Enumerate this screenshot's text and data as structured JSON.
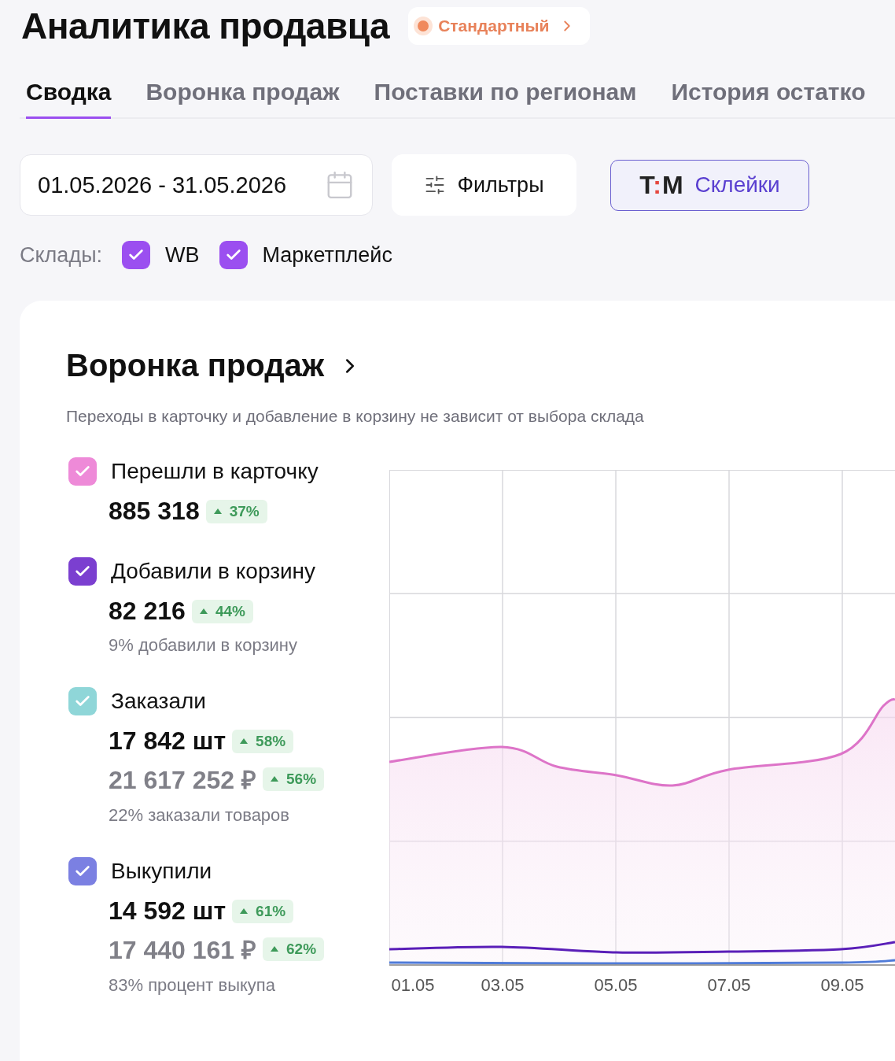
{
  "header": {
    "title": "Аналитика продавца",
    "plan_badge": {
      "label": "Стандартный"
    }
  },
  "tabs": [
    {
      "label": "Сводка",
      "selected": true
    },
    {
      "label": "Воронка продаж",
      "selected": false
    },
    {
      "label": "Поставки по регионам",
      "selected": false
    },
    {
      "label": "История остатко",
      "selected": false
    }
  ],
  "toolbar": {
    "date_range": {
      "value": "01.05.2026 - 31.05.2026"
    },
    "filters_button": {
      "label": "Фильтры"
    },
    "bundles_button": {
      "logo": [
        {
          "text": "T",
          "accent": false
        },
        {
          "text": ":",
          "accent": true
        },
        {
          "text": "M",
          "accent": false
        }
      ],
      "label": "Склейки"
    }
  },
  "warehouses": {
    "label": "Склады:",
    "options": [
      {
        "label": "WB",
        "checked": true
      },
      {
        "label": "Маркетплейс",
        "checked": true
      }
    ]
  },
  "funnel": {
    "title": "Воронка продаж",
    "subtitle": "Переходы в карточку и добавление в корзину не зависит от выбора склада",
    "metrics": [
      {
        "label": "Перешли в карточку",
        "color": "#ee8ad8",
        "checked": true,
        "values": [
          {
            "value": "885 318",
            "change": "37%",
            "muted": false
          }
        ]
      },
      {
        "label": "Добавили в корзину",
        "color": "#7b3fd0",
        "checked": true,
        "values": [
          {
            "value": "82 216",
            "change": "44%",
            "muted": false
          }
        ],
        "note": "9% добавили в корзину"
      },
      {
        "label": "Заказали",
        "color": "#8fd6d8",
        "checked": true,
        "values": [
          {
            "value": "17 842 шт",
            "change": "58%",
            "muted": false
          },
          {
            "value": "21 617 252 ₽",
            "change": "56%",
            "muted": true
          }
        ],
        "note": "22% заказали товаров"
      },
      {
        "label": "Выкупили",
        "color": "#7b80e2",
        "checked": true,
        "values": [
          {
            "value": "14 592 шт",
            "change": "61%",
            "muted": false
          },
          {
            "value": "17 440 161 ₽",
            "change": "62%",
            "muted": true
          }
        ],
        "note": "83% процент выкупа"
      }
    ],
    "chart": {
      "x_labels": [
        "01.05",
        "03.05",
        "05.05",
        "07.05",
        "09.05"
      ]
    }
  }
}
